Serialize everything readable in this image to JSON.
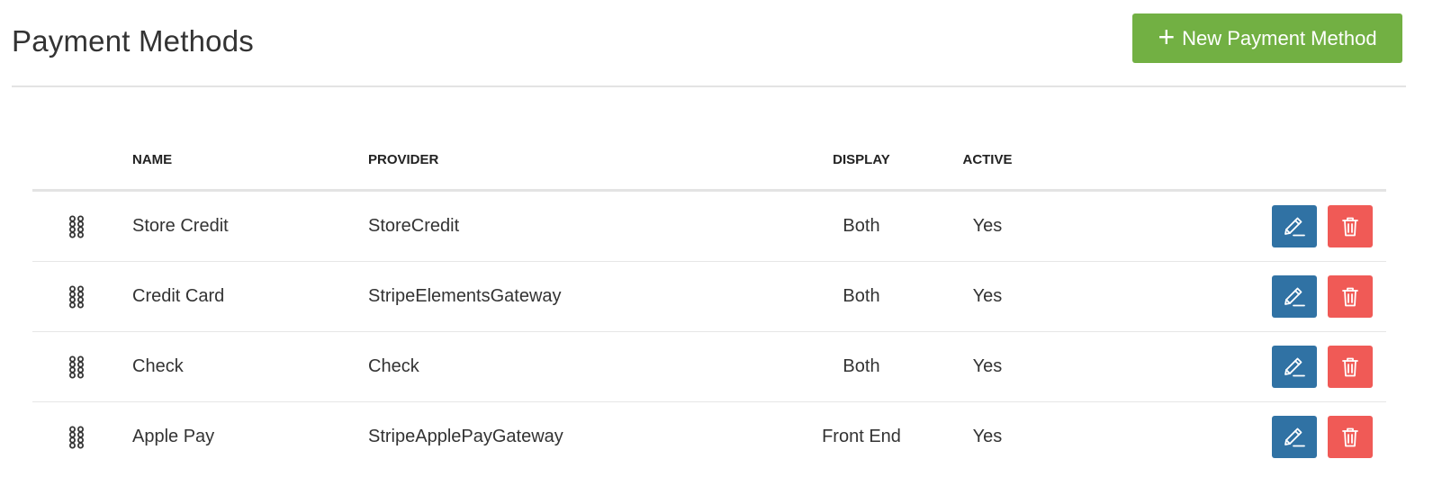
{
  "header": {
    "title": "Payment Methods",
    "new_button_icon": "+",
    "new_button_label": "New Payment Method"
  },
  "colors": {
    "primary_green": "#72b043",
    "edit_blue": "#3072a4",
    "delete_red": "#f05a56"
  },
  "table": {
    "columns": {
      "name": "NAME",
      "provider": "PROVIDER",
      "display": "DISPLAY",
      "active": "ACTIVE"
    },
    "rows": [
      {
        "name": "Store Credit",
        "provider": "StoreCredit",
        "display": "Both",
        "active": "Yes"
      },
      {
        "name": "Credit Card",
        "provider": "StripeElementsGateway",
        "display": "Both",
        "active": "Yes"
      },
      {
        "name": "Check",
        "provider": "Check",
        "display": "Both",
        "active": "Yes"
      },
      {
        "name": "Apple Pay",
        "provider": "StripeApplePayGateway",
        "display": "Front End",
        "active": "Yes"
      }
    ],
    "row_icons": {
      "drag": "drag-handle-icon",
      "edit": "pencil-icon",
      "delete": "trash-icon"
    }
  }
}
